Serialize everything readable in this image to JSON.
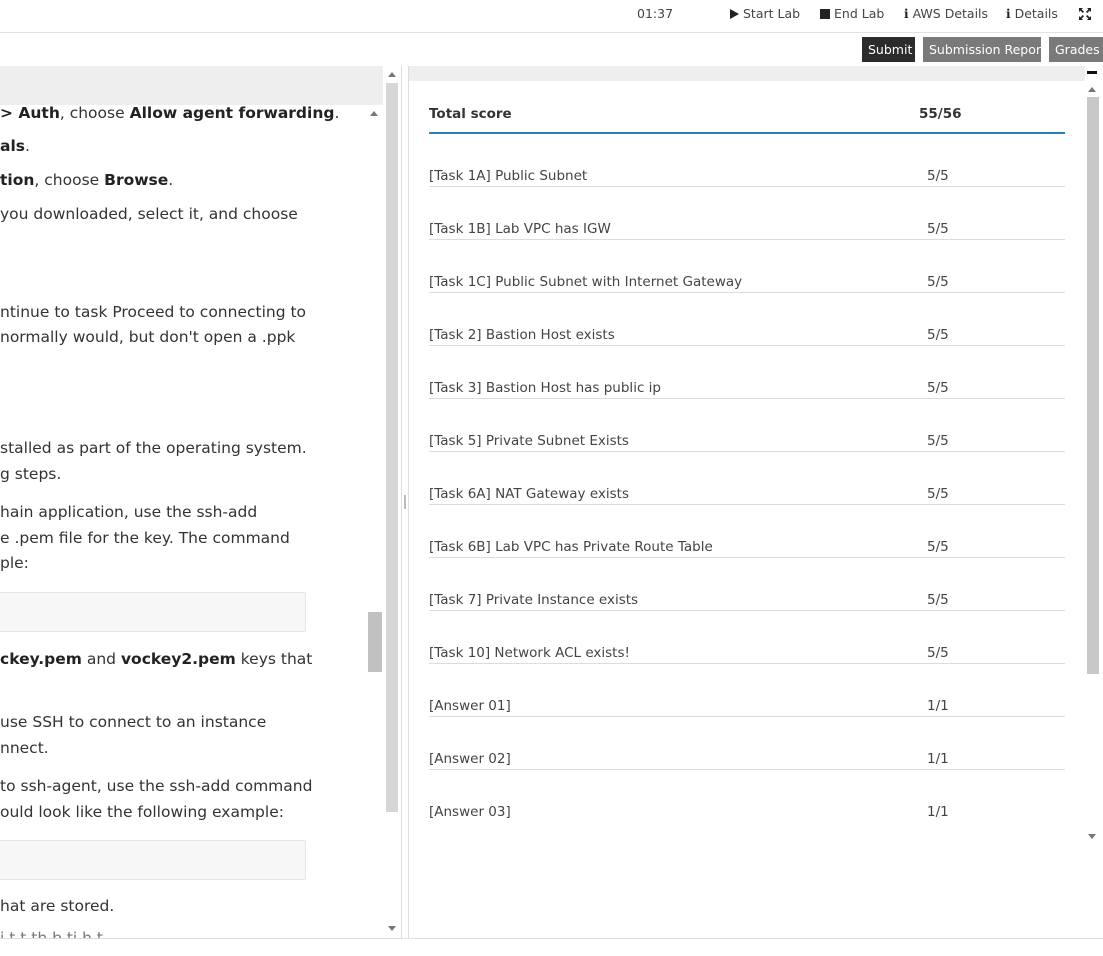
{
  "topbar": {
    "timer": "01:37",
    "start_lab": "Start Lab",
    "end_lab": "End Lab",
    "aws_details": "AWS Details",
    "details": "Details",
    "info_glyph": "i"
  },
  "actions": {
    "submit": "Submit",
    "submission_report": "Submission Report",
    "grades": "Grades",
    "colors": {
      "submit_bg": "#2c2c2c",
      "secondary_bg": "#7a7a7a"
    }
  },
  "instructions": {
    "l1": {
      "b1": "> Auth",
      "t1": ", choose ",
      "b2": "Allow agent forwarding",
      "t2": "."
    },
    "l2": {
      "b1": "als",
      "t1": "."
    },
    "l3": {
      "b1": "tion",
      "t1": ", choose ",
      "b2": "Browse",
      "t2": "."
    },
    "l4": "you downloaded, select it, and choose",
    "l5": "ntinue to task Proceed to connecting to",
    "l6": "normally would, but don't open a .ppk",
    "l7": "stalled as part of the operating system.",
    "l8": "g steps.",
    "l9": "hain application, use the ssh-add",
    "l10": "e .pem file for the key. The command",
    "l11": "ple:",
    "l12": {
      "b1": "ckey.pem",
      "t1": " and ",
      "b2": "vockey2.pem",
      "t2": " keys that"
    },
    "l13": "use SSH to connect to an instance",
    "l14": "nnect.",
    "l15": "to ssh-agent, use the ssh-add command",
    "l16": "ould look like the following example:",
    "l17": "hat are stored.",
    "l18": "i                   t t  th  b  ti   h  t"
  },
  "grades": {
    "header": {
      "name": "Total score",
      "score": "55/56"
    },
    "rows": [
      {
        "name": "[Task 1A] Public Subnet",
        "score": "5/5"
      },
      {
        "name": "[Task 1B] Lab VPC has IGW",
        "score": "5/5"
      },
      {
        "name": "[Task 1C] Public Subnet with Internet Gateway",
        "score": "5/5"
      },
      {
        "name": "[Task 2] Bastion Host exists",
        "score": "5/5"
      },
      {
        "name": "[Task 3] Bastion Host has public ip",
        "score": "5/5"
      },
      {
        "name": "[Task 5] Private Subnet Exists",
        "score": "5/5"
      },
      {
        "name": "[Task 6A] NAT Gateway exists",
        "score": "5/5"
      },
      {
        "name": "[Task 6B] Lab VPC has Private Route Table",
        "score": "5/5"
      },
      {
        "name": "[Task 7] Private Instance exists",
        "score": "5/5"
      },
      {
        "name": "[Task 10] Network ACL exists!",
        "score": "5/5"
      },
      {
        "name": "[Answer 01]",
        "score": "1/1"
      },
      {
        "name": "[Answer 02]",
        "score": "1/1"
      },
      {
        "name": "[Answer 03]",
        "score": "1/1"
      }
    ],
    "accent_color": "#2b7fb3"
  },
  "icons": {
    "start": "play-icon",
    "end": "stop-icon",
    "info": "info-icon",
    "expand": "expand-icon"
  }
}
